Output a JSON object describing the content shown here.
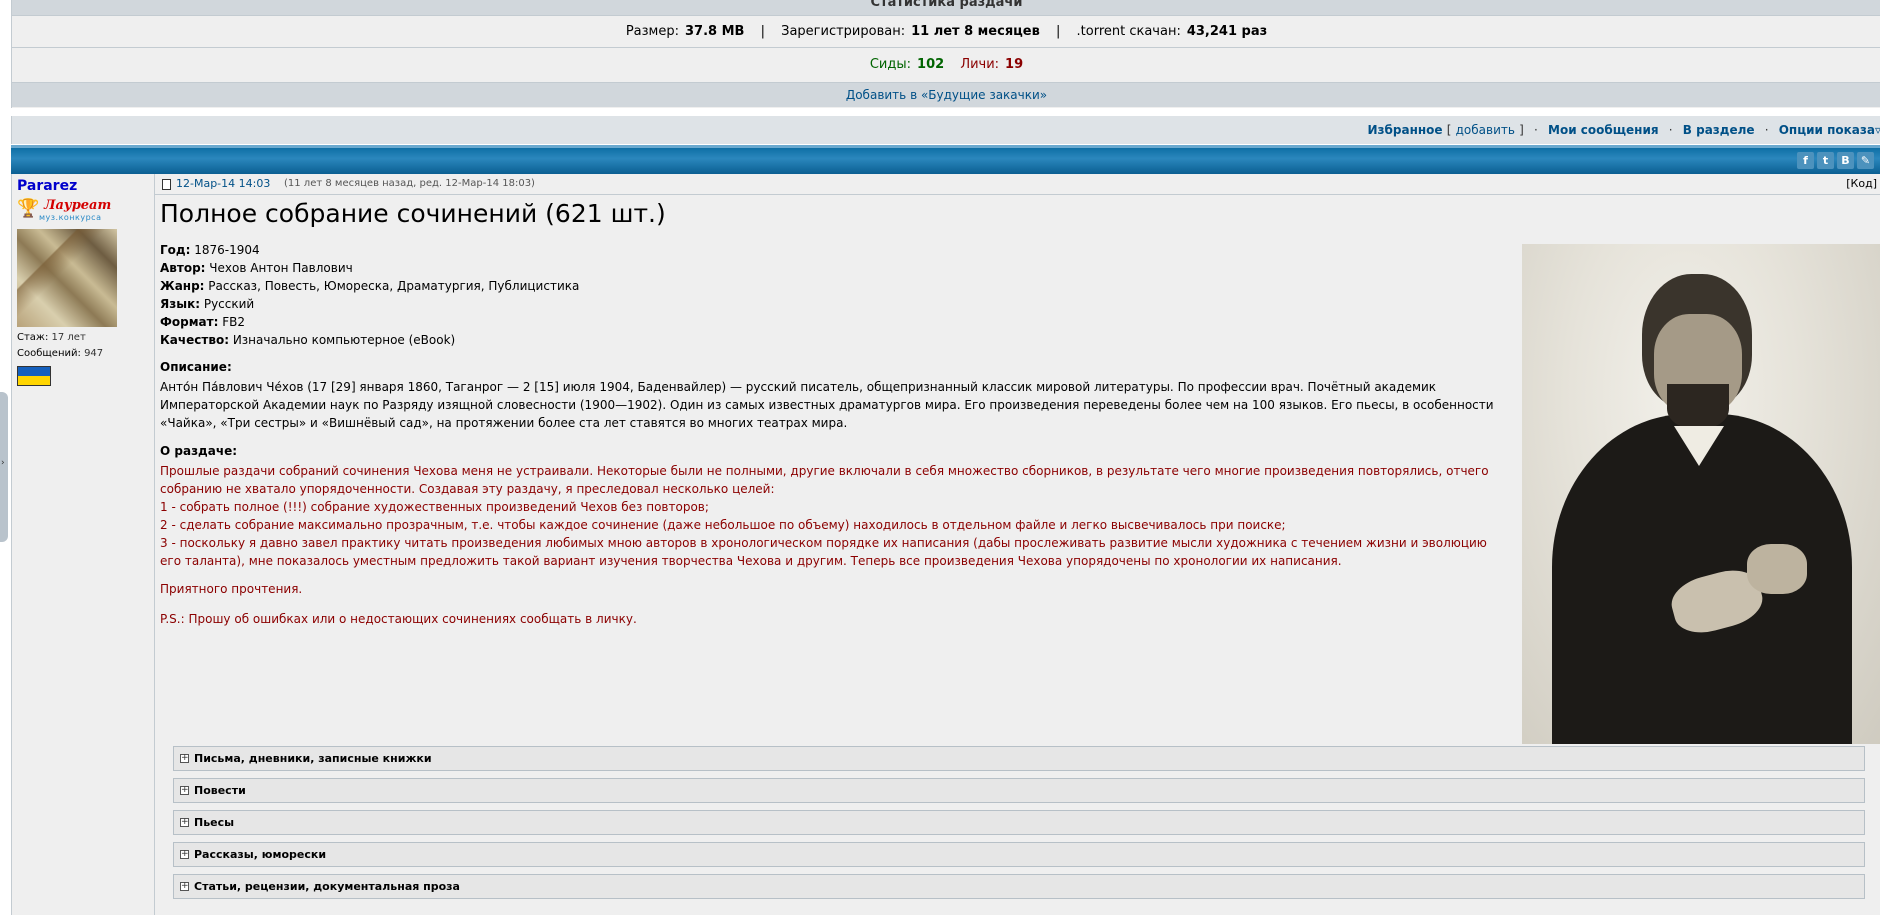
{
  "stats": {
    "title": "Статистика раздачи",
    "size_label": "Размер:",
    "size_value": "37.8 MB",
    "registered_label": "Зарегистрирован:",
    "registered_value": "11 лет 8 месяцев",
    "torrent_label": ".torrent скачан:",
    "torrent_value": "43,241 раз",
    "seeds_label": "Сиды:",
    "seeds_value": "102",
    "leechers_label": "Личи:",
    "leechers_value": "19",
    "future_link": "Добавить в «Будущие закачки»"
  },
  "nav": {
    "favorites": "Избранное",
    "bracket_open": "[",
    "add": "добавить",
    "bracket_close": "]",
    "my_messages": "Мои сообщения",
    "in_section": "В разделе",
    "display_options": "Опции показа"
  },
  "share": {
    "icons": [
      "facebook-icon",
      "twitter-icon",
      "vk-icon",
      "livejournal-icon"
    ],
    "letters": [
      "f",
      "t",
      "B",
      "✎"
    ]
  },
  "profile": {
    "nick": "Pararez",
    "award_title": "Лауреат",
    "award_sub": "муз.конкурса",
    "stazh_label": "Стаж:",
    "stazh_value": "17 лет",
    "messages_label": "Сообщений:",
    "messages_value": "947"
  },
  "post": {
    "date": "12-Мар-14 14:03",
    "ago": "(11 лет 8 месяцев назад, ред. 12-Мар-14 18:03)",
    "code": "[Код]",
    "title": "Полное собрание сочинений (621 шт.)",
    "year_label": "Год:",
    "year": "1876-1904",
    "author_label": "Автор:",
    "author": "Чехов Антон Павлович",
    "genre_label": "Жанр:",
    "genre": "Рассказ, Повесть, Юмореска, Драматургия, Публицистика",
    "lang_label": "Язык:",
    "lang": "Русский",
    "format_label": "Формат:",
    "format": "FB2",
    "quality_label": "Качество:",
    "quality": "Изначально компьютерное (eBook)",
    "description_label": "Описание:",
    "description": "Анто́н Па́влович Че́хов (17 [29] января 1860, Таганрог — 2 [15] июля 1904, Баденвайлер) — русский писатель, общепризнанный классик мировой литературы. По профессии врач. Почётный академик Императорской Академии наук по Разряду изящной словесности (1900—1902). Один из самых известных драматургов мира. Его произведения переведены более чем на 100 языков. Его пьесы, в особенности «Чайка», «Три сестры» и «Вишнёвый сад», на протяжении более ста лет ставятся во многих театрах мира.",
    "about_label": "О раздаче:",
    "about_lines": [
      "Прошлые раздачи собраний сочинения Чехова меня не устраивали. Некоторые были не полными, другие включали в себя множество сборников, в результате чего многие произведения повторялись, отчего собранию не хватало упорядоченности. Создавая эту раздачу, я преследовал несколько целей:",
      "1 - собрать полное (!!!) собрание художественных произведений Чехов без повторов;",
      "2 - сделать собрание максимально прозрачным, т.е. чтобы каждое сочинение (даже небольшое по объему) находилось в отдельном файле и легко высвечивалось при поиске;",
      "3 - поскольку я давно завел практику читать произведения любимых мною авторов в хронологическом порядке их написания (дабы прослеживать развитие мысли художника с течением жизни и эволюцию его таланта), мне показалось уместным предложить такой вариант изучения творчества Чехова и другим. Теперь все произведения Чехова упорядочены по хронологии их написания."
    ],
    "greeting": "Приятного прочтения.",
    "ps": "P.S.: Прошу об ошибках или о недостающих сочинениях сообщать в личку."
  },
  "spoilers": [
    "Письма, дневники, записные книжки",
    "Повести",
    "Пьесы",
    "Рассказы, юморески",
    "Статьи, рецензии, документальная проза"
  ],
  "colors": {
    "accent_blue": "#005087",
    "header_blue": "#0e6fa5",
    "seed_green": "#006400",
    "leech_red": "#8b0000"
  }
}
